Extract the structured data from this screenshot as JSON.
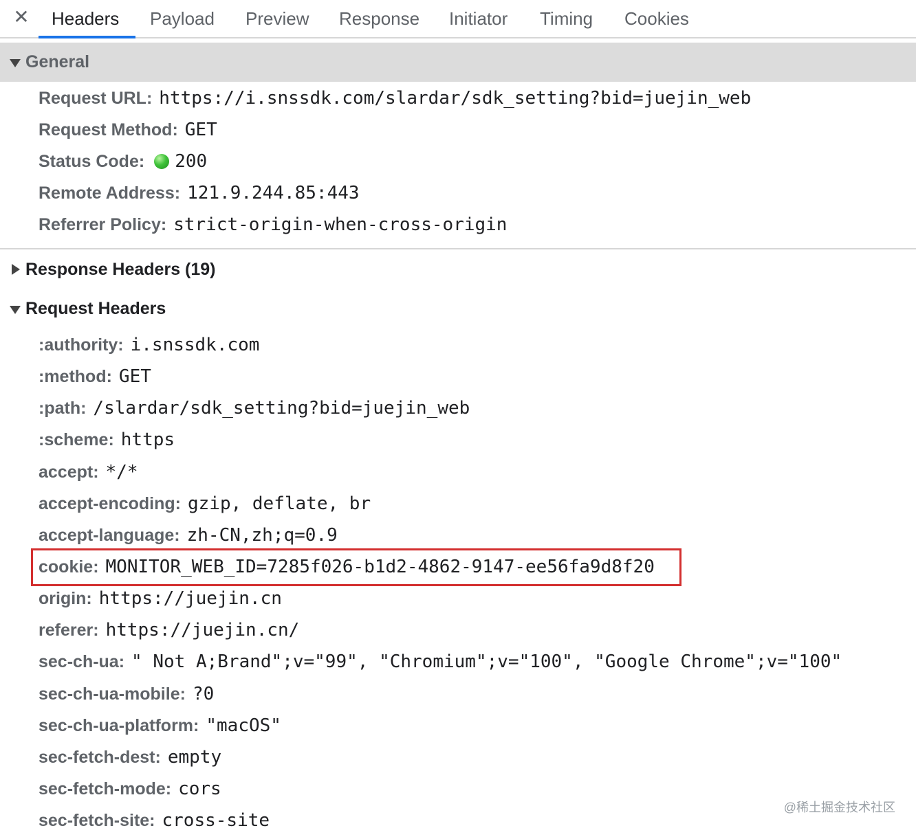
{
  "tabbar": {
    "close_icon": "✕",
    "tabs": [
      {
        "label": "Headers",
        "active": true
      },
      {
        "label": "Payload"
      },
      {
        "label": "Preview"
      },
      {
        "label": "Response"
      },
      {
        "label": "Initiator"
      },
      {
        "label": "Timing"
      },
      {
        "label": "Cookies"
      }
    ]
  },
  "general": {
    "title": "General",
    "rows": [
      {
        "key": "Request URL:",
        "value": "https://i.snssdk.com/slardar/sdk_setting?bid=juejin_web"
      },
      {
        "key": "Request Method:",
        "value": "GET"
      },
      {
        "key": "Status Code:",
        "value": "200",
        "status_color": "#3fc23a"
      },
      {
        "key": "Remote Address:",
        "value": "121.9.244.85:443"
      },
      {
        "key": "Referrer Policy:",
        "value": "strict-origin-when-cross-origin"
      }
    ]
  },
  "response_headers": {
    "title": "Response Headers (19)"
  },
  "request_headers": {
    "title": "Request Headers",
    "rows": [
      {
        "key": ":authority:",
        "value": "i.snssdk.com"
      },
      {
        "key": ":method:",
        "value": "GET"
      },
      {
        "key": ":path:",
        "value": "/slardar/sdk_setting?bid=juejin_web"
      },
      {
        "key": ":scheme:",
        "value": "https"
      },
      {
        "key": "accept:",
        "value": "*/*"
      },
      {
        "key": "accept-encoding:",
        "value": "gzip, deflate, br"
      },
      {
        "key": "accept-language:",
        "value": "zh-CN,zh;q=0.9"
      },
      {
        "key": "cookie:",
        "value": "MONITOR_WEB_ID=7285f026-b1d2-4862-9147-ee56fa9d8f20",
        "highlighted": true
      },
      {
        "key": "origin:",
        "value": "https://juejin.cn"
      },
      {
        "key": "referer:",
        "value": "https://juejin.cn/"
      },
      {
        "key": "sec-ch-ua:",
        "value": "\" Not A;Brand\";v=\"99\", \"Chromium\";v=\"100\", \"Google Chrome\";v=\"100\""
      },
      {
        "key": "sec-ch-ua-mobile:",
        "value": "?0"
      },
      {
        "key": "sec-ch-ua-platform:",
        "value": "\"macOS\""
      },
      {
        "key": "sec-fetch-dest:",
        "value": "empty"
      },
      {
        "key": "sec-fetch-mode:",
        "value": "cors"
      },
      {
        "key": "sec-fetch-site:",
        "value": "cross-site"
      }
    ]
  },
  "colors": {
    "accent": "#1a73e8",
    "highlight": "#d32f2f"
  },
  "watermark": "@稀土掘金技术社区"
}
